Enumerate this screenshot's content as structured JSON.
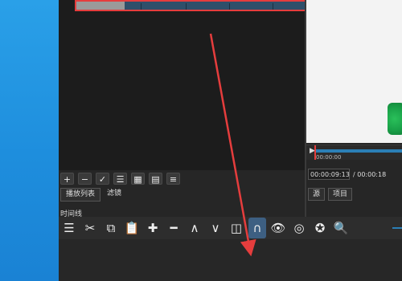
{
  "colors": {
    "accent": "#2b7fb6",
    "highlight_box": "#e53d3d",
    "annotation_arrow": "#e53d3d",
    "desktop": "#1e8edd"
  },
  "playlist": {
    "toolbar": [
      {
        "icon": "plus-icon",
        "glyph": "+"
      },
      {
        "icon": "minus-icon",
        "glyph": "−"
      },
      {
        "icon": "check-icon",
        "glyph": "✓"
      },
      {
        "icon": "list-view-icon",
        "glyph": "☰"
      },
      {
        "icon": "grid-view-icon",
        "glyph": "▦"
      },
      {
        "icon": "table-view-icon",
        "glyph": "▤"
      },
      {
        "icon": "menu-icon",
        "glyph": "≡"
      }
    ],
    "tabs": [
      "播放列表",
      "滤镜"
    ]
  },
  "player": {
    "ruler_label": "00:00:00",
    "ruler_tick": "00:00:00",
    "timecode_current": "00:00:09:13",
    "timecode_total": "/ 00:00:18",
    "tabs": [
      "源",
      "项目"
    ]
  },
  "timeline": {
    "title": "时间线",
    "toolbar": [
      {
        "icon": "menu-icon",
        "glyph": "☰"
      },
      {
        "icon": "cut-icon",
        "glyph": "✂"
      },
      {
        "icon": "copy-icon",
        "glyph": "⧉"
      },
      {
        "icon": "paste-icon",
        "glyph": "📋"
      },
      {
        "icon": "append-icon",
        "glyph": "✚"
      },
      {
        "icon": "remove-icon",
        "glyph": "━"
      },
      {
        "icon": "lift-icon",
        "glyph": "∧"
      },
      {
        "icon": "overwrite-icon",
        "glyph": "∨"
      },
      {
        "icon": "split-icon",
        "glyph": "◫"
      },
      {
        "icon": "snap-magnet-icon",
        "glyph": "∩",
        "active": true
      },
      {
        "icon": "scrub-eye-icon",
        "glyph": "👁"
      },
      {
        "icon": "ripple-icon",
        "glyph": "◎"
      },
      {
        "icon": "ripple-all-icon",
        "glyph": "✪"
      },
      {
        "icon": "zoom-out-icon",
        "glyph": "🔍"
      }
    ]
  }
}
